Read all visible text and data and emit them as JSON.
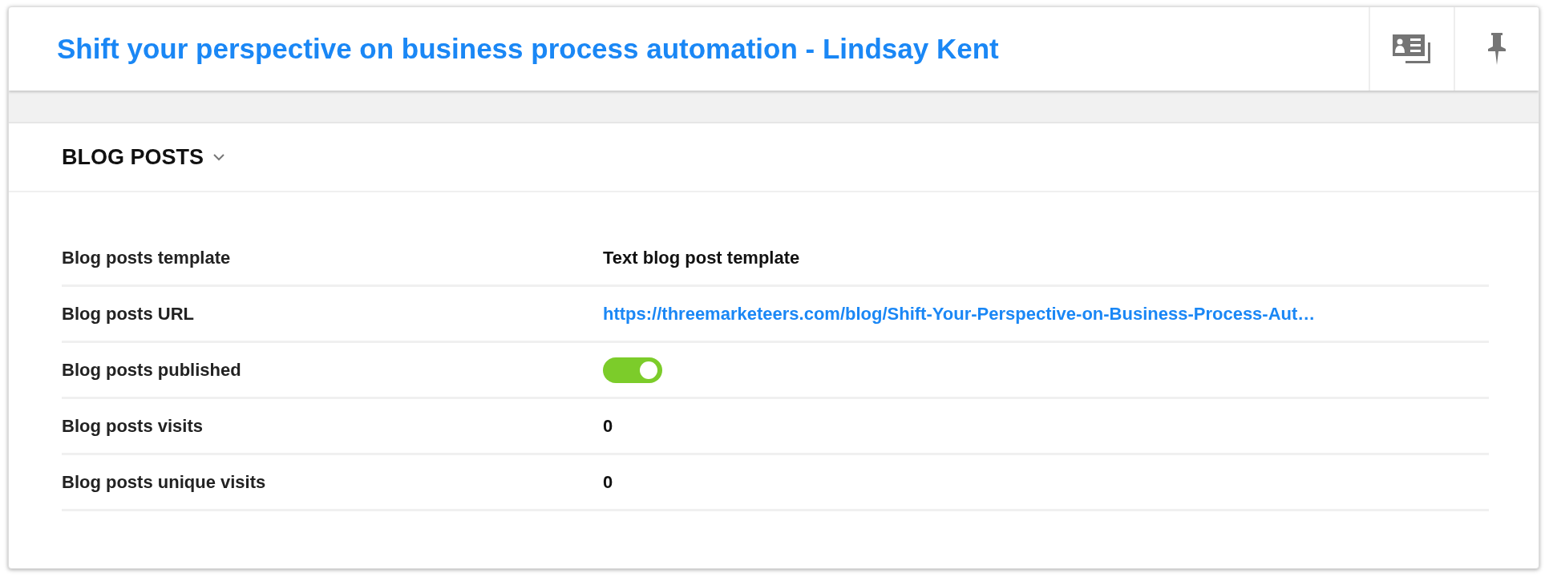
{
  "header": {
    "title": "Shift your perspective on business process automation - Lindsay Kent"
  },
  "section": {
    "title": "BLOG POSTS",
    "expanded": true
  },
  "fields": [
    {
      "kind": "text",
      "label": "Blog posts template",
      "value": "Text blog post template"
    },
    {
      "kind": "link",
      "label": "Blog posts URL",
      "value": "https://threemarketeers.com/blog/Shift-Your-Perspective-on-Business-Process-Aut…"
    },
    {
      "kind": "toggle",
      "label": "Blog posts published",
      "on": true
    },
    {
      "kind": "text",
      "label": "Blog posts visits",
      "value": "0"
    },
    {
      "kind": "text",
      "label": "Blog posts unique visits",
      "value": "0"
    }
  ]
}
